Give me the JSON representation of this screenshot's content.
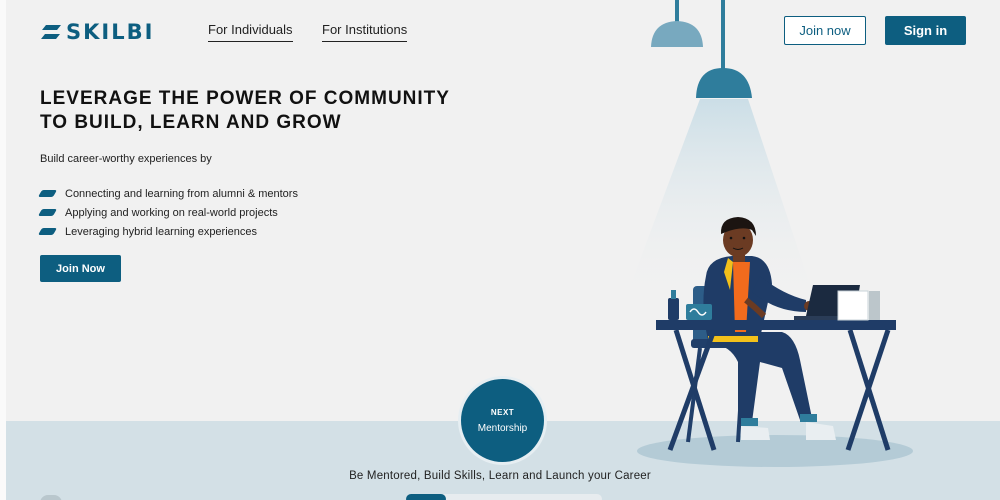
{
  "header": {
    "logo_text": "SKILBI",
    "nav": {
      "individuals": "For Individuals",
      "institutions": "For Institutions"
    },
    "join_label": "Join now",
    "signin_label": "Sign in"
  },
  "hero": {
    "headline_line1": "LEVERAGE THE POWER OF COMMUNITY",
    "headline_line2": "TO BUILD, LEARN AND GROW",
    "subhead": "Build career-worthy experiences by",
    "bullets": [
      "Connecting and learning from alumni & mentors",
      "Applying and working on real-world projects",
      "Leveraging hybrid learning experiences"
    ],
    "cta_label": "Join Now"
  },
  "next": {
    "label": "NEXT",
    "title": "Mentorship"
  },
  "tagline": "Be Mentored, Build Skills, Learn and Launch your Career",
  "icons": {
    "logo": "skilbi-logo-icon",
    "bullet": "skewed-dash-icon"
  },
  "colors": {
    "brand": "#0d5e80",
    "lamp": "#2f7d9c",
    "shirt": "#f26b1d",
    "jacket": "#1f3c67",
    "floor": "#d3e0e6",
    "background": "#f1f1f1"
  }
}
